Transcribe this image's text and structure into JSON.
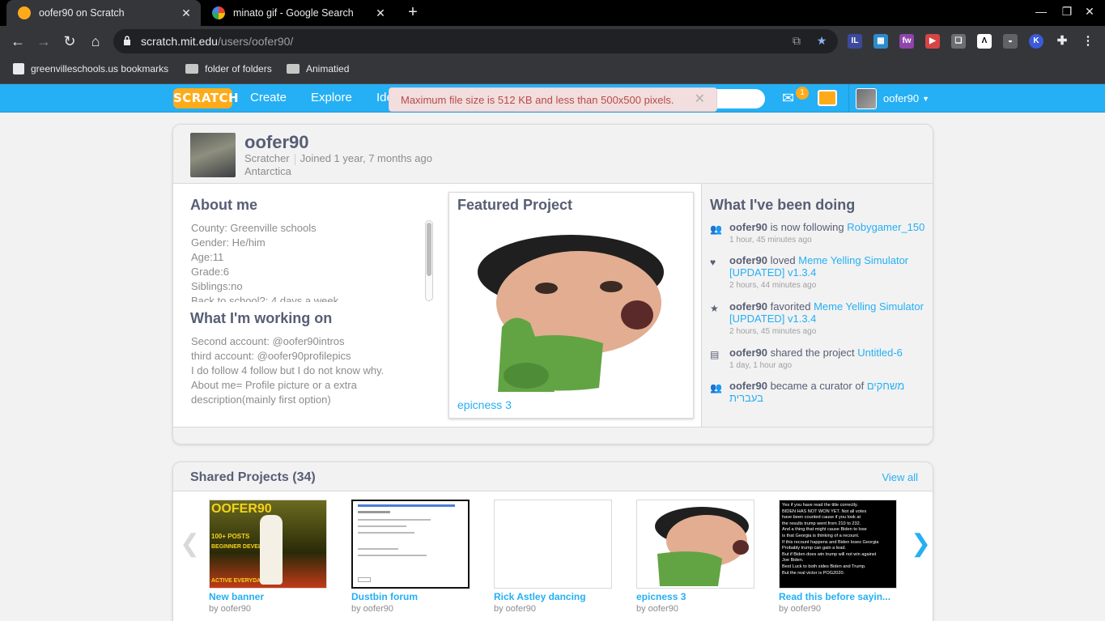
{
  "browser": {
    "tabs": [
      {
        "title": "oofer90 on Scratch",
        "active": true
      },
      {
        "title": "minato gif - Google Search",
        "active": false
      }
    ],
    "url_host": "scratch.mit.edu",
    "url_path": "/users/oofer90/",
    "bookmarks": [
      "greenvilleschools.us bookmarks",
      "folder of folders",
      "Animatied"
    ],
    "extension_badge": "1"
  },
  "scratch_nav": {
    "logo": "SCRATCH",
    "links": [
      "Create",
      "Explore",
      "Ide"
    ],
    "message_count": "1",
    "username": "oofer90"
  },
  "alert": {
    "text": "Maximum file size is 512 KB and less than 500x500 pixels."
  },
  "profile": {
    "username": "oofer90",
    "role": "Scratcher",
    "joined": "Joined 1 year, 7 months ago",
    "location": "Antarctica"
  },
  "about_me": {
    "heading": "About me",
    "lines": [
      "County: Greenville schools",
      "Gender: He/him",
      "Age:11",
      "Grade:6",
      "Siblings:no",
      "Back to school?: 4 days a week"
    ]
  },
  "working_on": {
    "heading": "What I'm working on",
    "lines": [
      "Second account: @oofer90intros",
      "third account: @oofer90profilepics",
      "I do follow 4 follow but I do not know why.",
      "About me= Profile picture or a extra",
      "description(mainly first option)"
    ]
  },
  "featured": {
    "heading": "Featured Project",
    "project_title": "epicness 3"
  },
  "activity": {
    "heading": "What I've been doing",
    "items": [
      {
        "icon": "follow-icon",
        "who": "oofer90",
        "action": " is now following ",
        "target": "Robygamer_150",
        "when": "1 hour, 45 minutes ago"
      },
      {
        "icon": "heart-icon",
        "who": "oofer90",
        "action": " loved ",
        "target": "Meme Yelling Simulator [UPDATED] v1.3.4",
        "when": "2 hours, 44 minutes ago"
      },
      {
        "icon": "star-icon",
        "who": "oofer90",
        "action": " favorited ",
        "target": "Meme Yelling Simulator [UPDATED] v1.3.4",
        "when": "2 hours, 45 minutes ago"
      },
      {
        "icon": "share-icon",
        "who": "oofer90",
        "action": " shared the project ",
        "target": "Untitled-6",
        "when": "1 day, 1 hour ago"
      },
      {
        "icon": "curator-icon",
        "who": "oofer90",
        "action": " became a curator of ",
        "target": "משחקים בעברית",
        "when": ""
      }
    ]
  },
  "shared": {
    "heading": "Shared Projects (34)",
    "view_all": "View all",
    "projects": [
      {
        "title": "New banner",
        "by": "by oofer90",
        "thumb_lines": [
          "OOFER90",
          "100+ POSTS",
          "BEGINNER DEVELOPER",
          "ACTIVE EVERYDAY!"
        ]
      },
      {
        "title": "Dustbin forum",
        "by": "by oofer90",
        "thumb_lines": []
      },
      {
        "title": "Rick Astley dancing",
        "by": "by oofer90",
        "thumb_lines": []
      },
      {
        "title": "epicness 3",
        "by": "by oofer90",
        "thumb_lines": []
      },
      {
        "title": "Read this before sayin...",
        "by": "by oofer90",
        "thumb_lines": [
          "Yes if you have read the title correctly.",
          "BIDEN HAS NOT WON YET. Not all votes",
          "have been counted cause if you look at",
          "the results trump went from 210 to 232.",
          "And a thing that might cause Biden to lose",
          "is that Georgia is thinking of a recount.",
          "If this recount happens and Biden loses Georgia",
          "Probably trump can gain a lead.",
          "But if Biden does win trump will not win against",
          "Joe Biden.",
          "Best Luck to both sides Biden and Trump.",
          "But the real victor is POG2020."
        ]
      }
    ]
  }
}
